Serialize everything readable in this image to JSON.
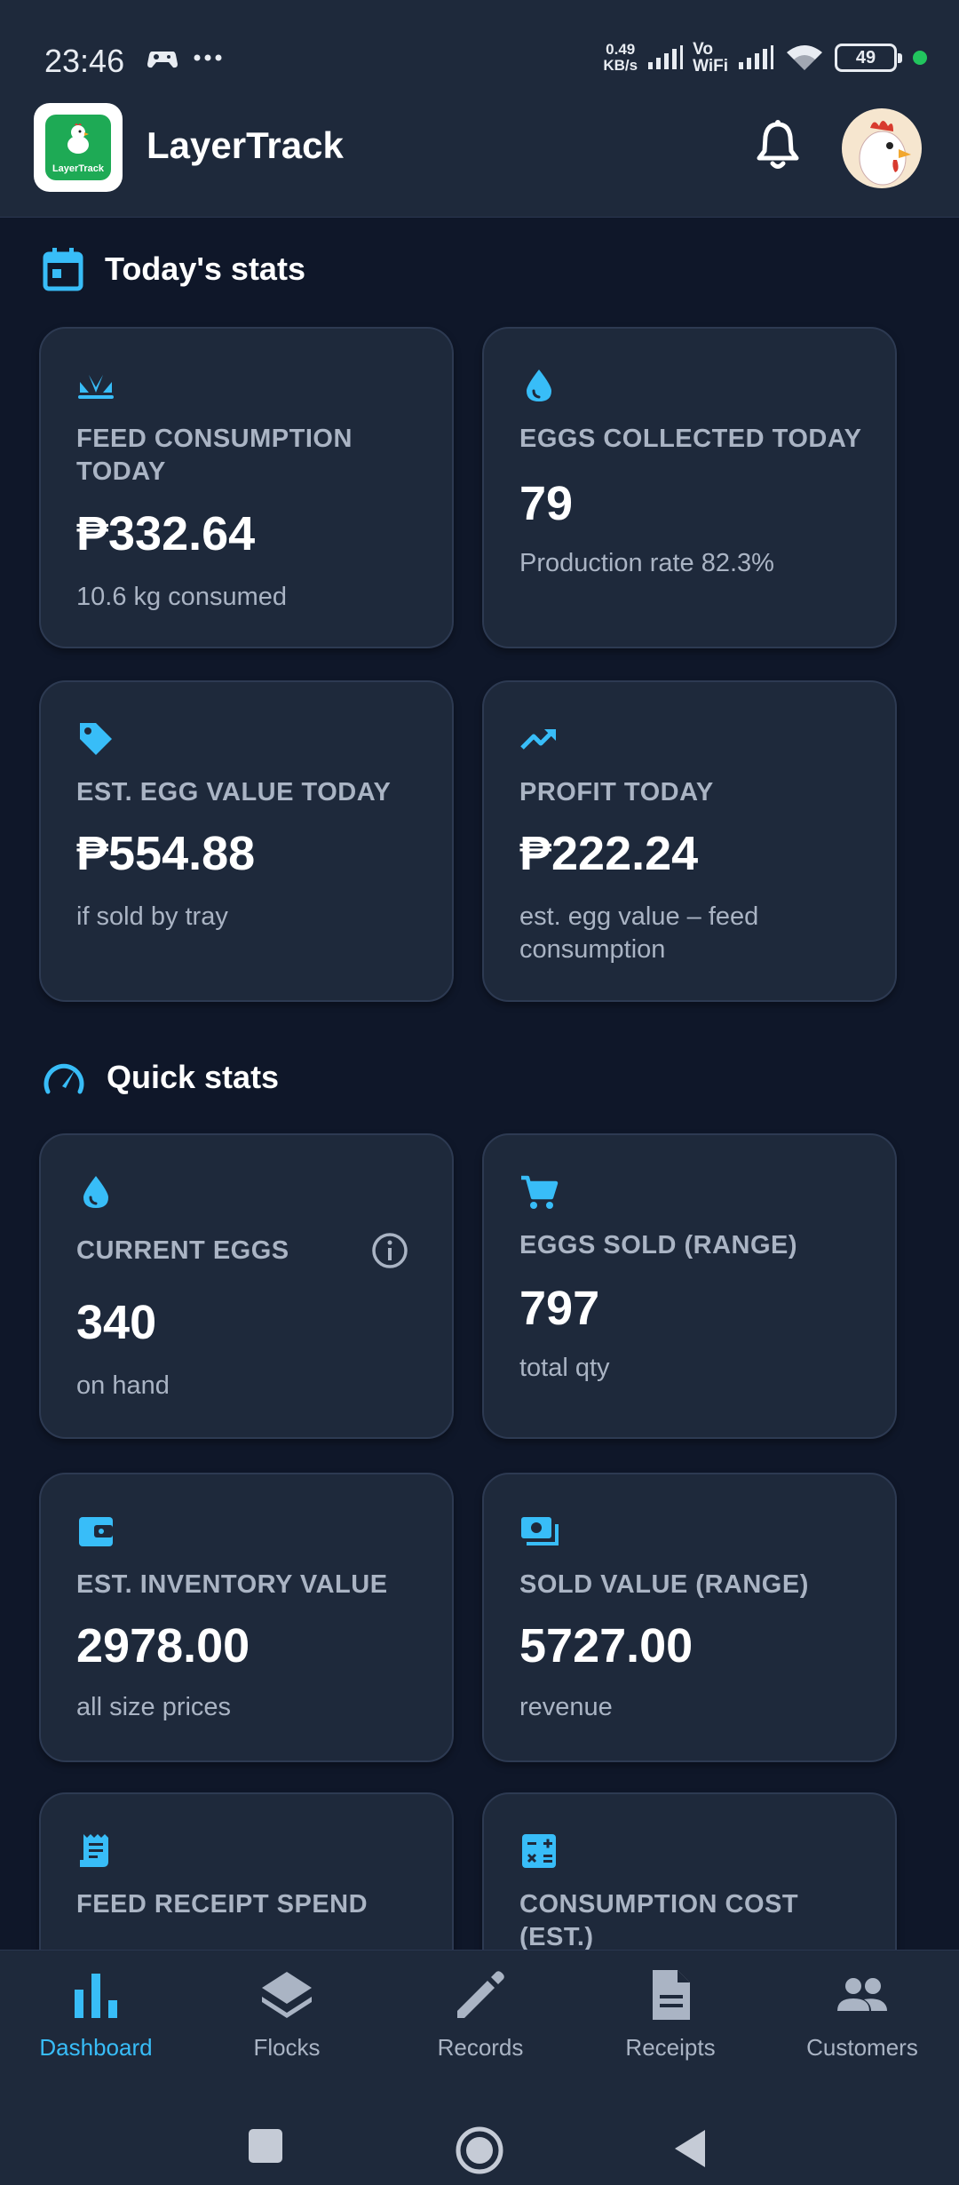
{
  "status_bar": {
    "time": "23:46",
    "speed_value": "0.49",
    "speed_unit": "KB/s",
    "vo_line1": "Vo",
    "vo_line2": "WiFi",
    "battery": "49"
  },
  "app": {
    "title": "LayerTrack",
    "logo_text": "LayerTrack"
  },
  "todays_stats": {
    "title": "Today's stats",
    "cards": [
      {
        "label": "FEED CONSUMPTION TODAY",
        "value": "₱332.64",
        "sub": "10.6 kg consumed",
        "icon": "feed-sprout-icon"
      },
      {
        "label": "EGGS COLLECTED TODAY",
        "value": "79",
        "sub": "Production rate 82.3%",
        "icon": "egg-drop-icon"
      },
      {
        "label": "EST. EGG VALUE TODAY",
        "value": "₱554.88",
        "sub": "if sold by tray",
        "icon": "price-tag-icon"
      },
      {
        "label": "PROFIT TODAY",
        "value": "₱222.24",
        "sub": "est. egg value – feed consumption",
        "icon": "trending-up-icon"
      }
    ]
  },
  "quick_stats": {
    "title": "Quick stats",
    "cards": [
      {
        "label": "CURRENT EGGS",
        "value": "340",
        "sub": "on hand",
        "icon": "egg-drop-icon"
      },
      {
        "label": "EGGS SOLD (RANGE)",
        "value": "797",
        "sub": "total qty",
        "icon": "cart-icon"
      },
      {
        "label": "EST. INVENTORY VALUE",
        "value": "2978.00",
        "sub": "all size prices",
        "icon": "wallet-icon"
      },
      {
        "label": "SOLD VALUE (RANGE)",
        "value": "5727.00",
        "sub": "revenue",
        "icon": "cash-icon"
      },
      {
        "label": "FEED RECEIPT SPEND",
        "icon": "receipt-icon"
      },
      {
        "label": "CONSUMPTION COST (EST.)",
        "icon": "calculator-icon"
      }
    ]
  },
  "bottom_nav": {
    "items": [
      {
        "label": "Dashboard",
        "icon": "bar-chart-icon",
        "active": true
      },
      {
        "label": "Flocks",
        "icon": "layers-icon",
        "active": false
      },
      {
        "label": "Records",
        "icon": "pencil-icon",
        "active": false
      },
      {
        "label": "Receipts",
        "icon": "document-icon",
        "active": false
      },
      {
        "label": "Customers",
        "icon": "people-icon",
        "active": false
      }
    ]
  },
  "colors": {
    "background": "#0f1729",
    "surface": "#1e293b",
    "accent": "#38bdf8",
    "muted_text": "#aab4c4"
  }
}
